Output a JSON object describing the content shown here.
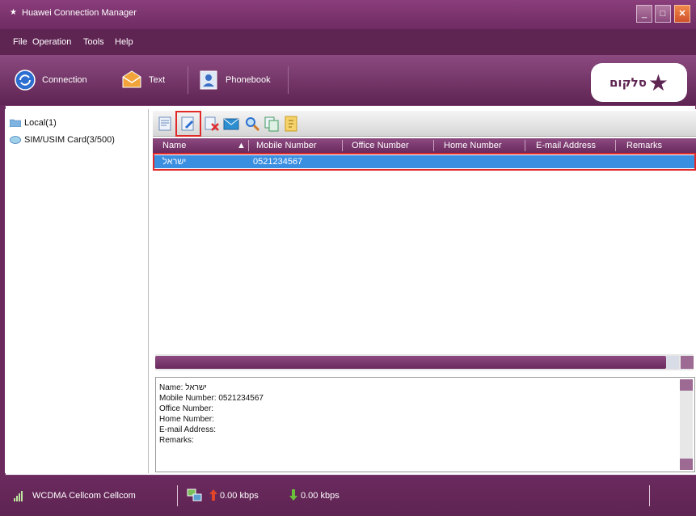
{
  "window": {
    "title": "Huawei Connection Manager"
  },
  "menu": {
    "items": [
      "File",
      "Operation",
      "Tools",
      "Help"
    ]
  },
  "toolbar": {
    "buttons": [
      {
        "label": "Connection",
        "icon": "connection-icon"
      },
      {
        "label": "Text",
        "icon": "envelope-icon"
      },
      {
        "label": "Phonebook",
        "icon": "phonebook-icon"
      }
    ],
    "logo_text": "סלקום",
    "colors": {
      "brand": "#6b2a5e",
      "highlight": "#e02a2a",
      "selection": "#3b8fe0"
    }
  },
  "tree": {
    "items": [
      {
        "label": "Local(1)",
        "icon": "folder-icon"
      },
      {
        "label": "SIM/USIM Card(3/500)",
        "icon": "sim-card-icon"
      }
    ]
  },
  "subtoolbar": {
    "icons": [
      "new-contact-icon",
      "edit-contact-icon",
      "delete-icon",
      "send-message-icon",
      "search-icon",
      "copy-icon",
      "export-icon"
    ]
  },
  "table": {
    "columns": [
      "Name",
      "Mobile Number",
      "Office Number",
      "Home Number",
      "E-mail Address",
      "Remarks"
    ],
    "sort_indicator": "▲",
    "rows": [
      {
        "name": "ישראל",
        "mobile": "0521234567",
        "office": "",
        "home": "",
        "email": "",
        "remarks": ""
      }
    ]
  },
  "detail": {
    "lines": [
      "Name: ישראל",
      "Mobile Number: 0521234567",
      "Office Number:",
      "Home Number:",
      "E-mail Address:",
      "Remarks:"
    ]
  },
  "status": {
    "network": "WCDMA Cellcom Cellcom",
    "upload": "0.00 kbps",
    "download": "0.00 kbps"
  }
}
